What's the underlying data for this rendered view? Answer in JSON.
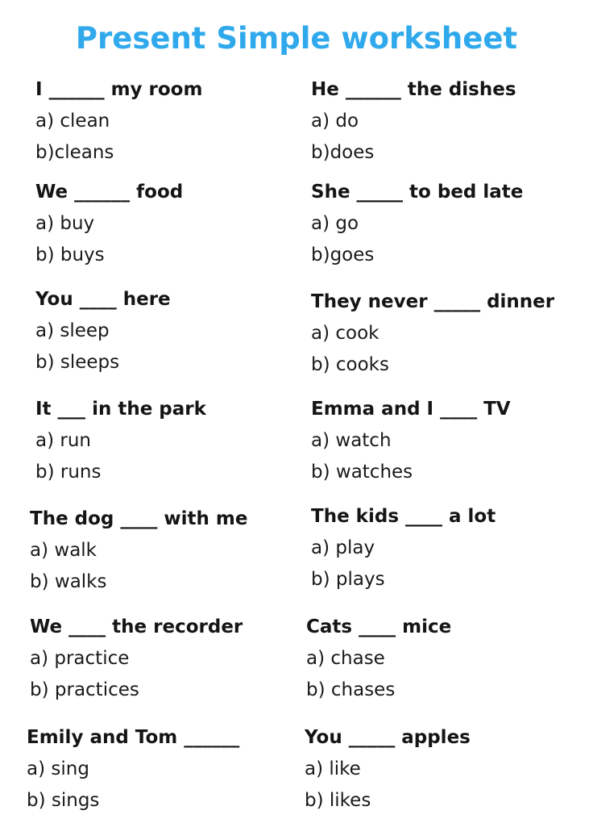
{
  "title": "Present Simple worksheet",
  "questions": [
    {
      "stem": "I ______ my room",
      "a": "a) clean",
      "b": "b)cleans"
    },
    {
      "stem": "He ______ the dishes",
      "a": "a) do",
      "b": "b)does"
    },
    {
      "stem": "We ______ food",
      "a": "a) buy",
      "b": "b) buys"
    },
    {
      "stem": "She _____ to bed late",
      "a": "a) go",
      "b": "b)goes"
    },
    {
      "stem": "You ____ here",
      "a": "a) sleep",
      "b": "b) sleeps"
    },
    {
      "stem": "They never _____ dinner",
      "a": "a) cook",
      "b": "b) cooks"
    },
    {
      "stem": "It ___ in the park",
      "a": "a) run",
      "b": "b) runs"
    },
    {
      "stem": "Emma and I ____ TV",
      "a": "a) watch",
      "b": "b) watches"
    },
    {
      "stem": "The dog ____ with me",
      "a": "a) walk",
      "b": "b) walks"
    },
    {
      "stem": "The kids ____ a lot",
      "a": "a) play",
      "b": "b) plays"
    },
    {
      "stem": "We ____ the recorder",
      "a": "a) practice",
      "b": "b) practices"
    },
    {
      "stem": "Cats ____ mice",
      "a": "a) chase",
      "b": "b) chases"
    },
    {
      "stem": "Emily and Tom ______",
      "a": "a) sing",
      "b": "b) sings"
    },
    {
      "stem": "You _____ apples",
      "a": "a) like",
      "b": "b) likes"
    }
  ]
}
